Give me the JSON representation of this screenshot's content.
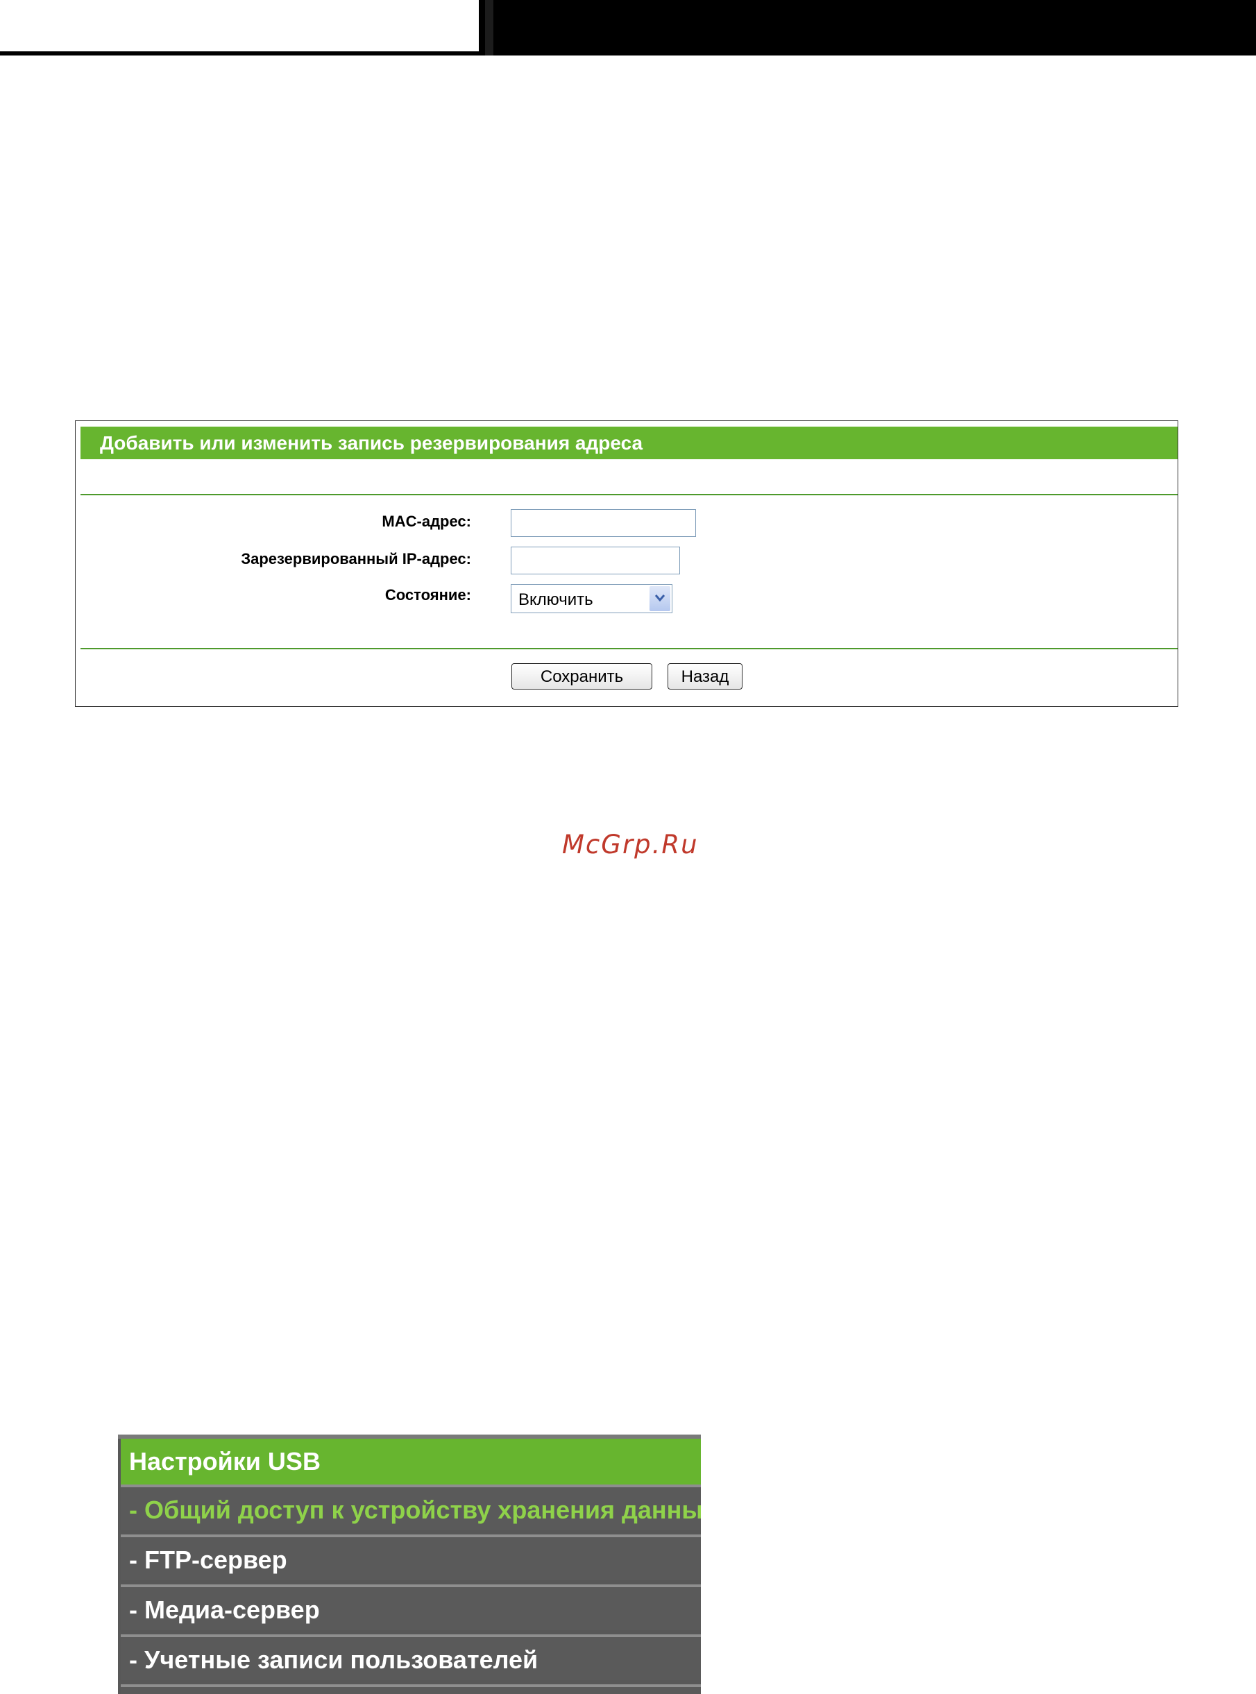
{
  "form": {
    "title": "Добавить или изменить запись резервирования адреса",
    "mac_label": "MAC-адрес:",
    "mac_value": "",
    "ip_label": "Зарезервированный IP-адрес:",
    "ip_value": "",
    "state_label": "Состояние:",
    "state_value": "Включить",
    "save_label": "Сохранить",
    "back_label": "Назад"
  },
  "watermark": "McGrp.Ru",
  "menu": {
    "header": "Настройки USB",
    "items": [
      {
        "label": "- Общий доступ к устройству хранения данных",
        "active": true
      },
      {
        "label": "- FTP-сервер",
        "active": false
      },
      {
        "label": "- Медиа-сервер",
        "active": false
      },
      {
        "label": "- Учетные записи пользователей",
        "active": false
      }
    ]
  },
  "colors": {
    "accent_green": "#67b52f",
    "menu_bg": "#5a5a5a",
    "menu_active_text": "#8fd24a",
    "watermark": "#c0392b"
  }
}
